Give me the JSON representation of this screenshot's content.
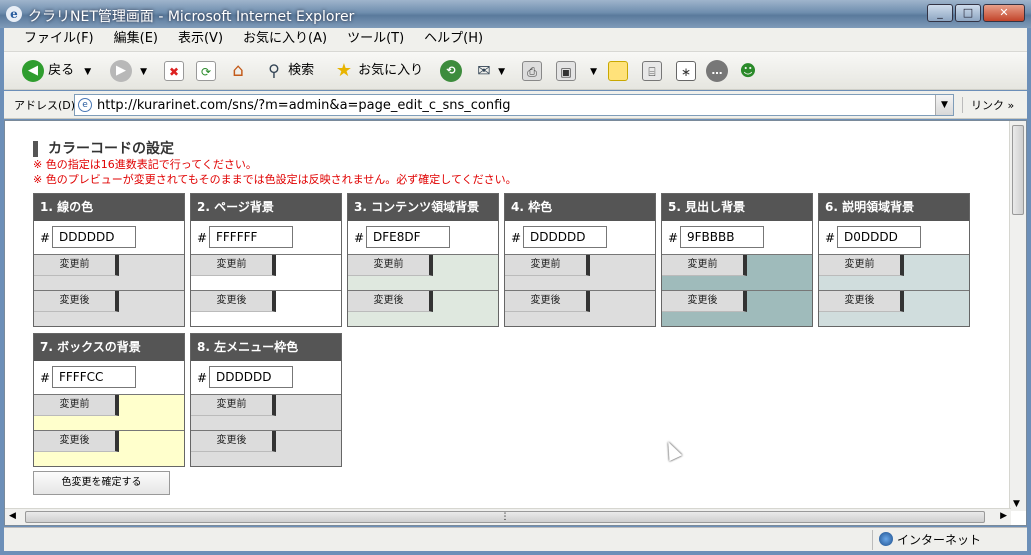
{
  "window": {
    "app_icon": "ie-icon",
    "title": "クラリNET管理画面 - Microsoft Internet Explorer",
    "controls": [
      "minimize-icon",
      "maximize-icon",
      "close-icon"
    ]
  },
  "menu": [
    "ファイル(F)",
    "編集(E)",
    "表示(V)",
    "お気に入り(A)",
    "ツール(T)",
    "ヘルプ(H)"
  ],
  "toolbar": {
    "back_label": "戻る",
    "search_label": "検索",
    "favorites_label": "お気に入り",
    "icons": [
      "back-icon",
      "forward-icon",
      "stop-icon",
      "refresh-icon",
      "home-icon",
      "search-icon",
      "favorites-icon",
      "history-icon",
      "mail-icon",
      "print-icon",
      "edit-icon",
      "discuss-icon",
      "scanner-icon",
      "research-icon",
      "messenger-icon",
      "msn-icon"
    ]
  },
  "address": {
    "label": "アドレス(D)",
    "url": "http://kurarinet.com/sns/?m=admin&a=page_edit_c_sns_config",
    "links_label": "リンク »"
  },
  "page": {
    "heading": "カラーコードの設定",
    "notes": [
      "※ 色の指定は16進数表記で行ってください。",
      "※ 色のプレビューが変更されてもそのままでは色設定は反映されません。必ず確定してください。"
    ],
    "before_label": "変更前",
    "after_label": "変更後",
    "confirm_label": "色変更を確定する",
    "cards": [
      {
        "title": "1. 線の色",
        "value": "DDDDDD",
        "color": "#DDDDDD"
      },
      {
        "title": "2. ページ背景",
        "value": "FFFFFF",
        "color": "#FFFFFF"
      },
      {
        "title": "3. コンテンツ領域背景",
        "value": "DFE8DF",
        "color": "#DFE8DF"
      },
      {
        "title": "4. 枠色",
        "value": "DDDDDD",
        "color": "#DDDDDD"
      },
      {
        "title": "5. 見出し背景",
        "value": "9FBBBB",
        "color": "#9FBBBB"
      },
      {
        "title": "6. 説明領域背景",
        "value": "D0DDDD",
        "color": "#D0DDDD"
      },
      {
        "title": "7. ボックスの背景",
        "value": "FFFFCC",
        "color": "#FFFFCC"
      },
      {
        "title": "8. 左メニュー枠色",
        "value": "DDDDDD",
        "color": "#DDDDDD"
      }
    ]
  },
  "status": {
    "zone": "インターネット"
  },
  "colors": {
    "card_header": "#555555",
    "note_red": "#e00000"
  }
}
